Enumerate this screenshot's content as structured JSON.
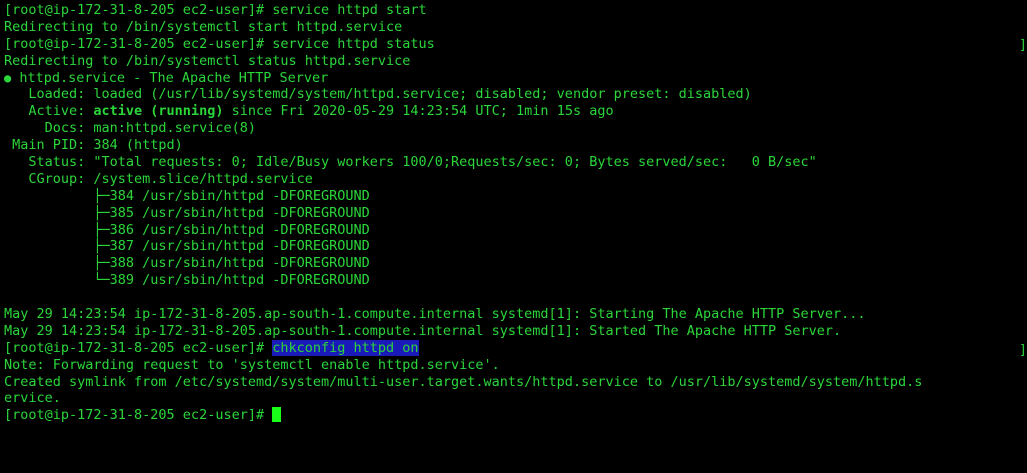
{
  "terminal": {
    "lines": {
      "l1": "[root@ip-172-31-8-205 ec2-user]# service httpd start",
      "l2": "Redirecting to /bin/systemctl start httpd.service",
      "l3": "[root@ip-172-31-8-205 ec2-user]# service httpd status",
      "l4": "Redirecting to /bin/systemctl status httpd.service",
      "l5_bullet": "●",
      "l5_text": " httpd.service - The Apache HTTP Server",
      "l6": "   Loaded: loaded (/usr/lib/systemd/system/httpd.service; disabled; vendor preset: disabled)",
      "l7_label": "   Active: ",
      "l7_status": "active (running)",
      "l7_rest": " since Fri 2020-05-29 14:23:54 UTC; 1min 15s ago",
      "l8": "     Docs: man:httpd.service(8)",
      "l9": " Main PID: 384 (httpd)",
      "l10": "   Status: \"Total requests: 0; Idle/Busy workers 100/0;Requests/sec: 0; Bytes served/sec:   0 B/sec\"",
      "l11": "   CGroup: /system.slice/httpd.service",
      "l12": "           ├─384 /usr/sbin/httpd -DFOREGROUND",
      "l13": "           ├─385 /usr/sbin/httpd -DFOREGROUND",
      "l14": "           ├─386 /usr/sbin/httpd -DFOREGROUND",
      "l15": "           ├─387 /usr/sbin/httpd -DFOREGROUND",
      "l16": "           ├─388 /usr/sbin/httpd -DFOREGROUND",
      "l17": "           └─389 /usr/sbin/httpd -DFOREGROUND",
      "l18": "",
      "l19": "May 29 14:23:54 ip-172-31-8-205.ap-south-1.compute.internal systemd[1]: Starting The Apache HTTP Server...",
      "l20": "May 29 14:23:54 ip-172-31-8-205.ap-south-1.compute.internal systemd[1]: Started The Apache HTTP Server.",
      "l21_prompt": "[root@ip-172-31-8-205 ec2-user]# ",
      "l21_cmd": "chkconfig httpd on",
      "l22": "Note: Forwarding request to 'systemctl enable httpd.service'.",
      "l23": "Created symlink from /etc/systemd/system/multi-user.target.wants/httpd.service to /usr/lib/systemd/system/httpd.s",
      "l24": "ervice.",
      "l25_prompt": "[root@ip-172-31-8-205 ec2-user]# "
    }
  },
  "colors": {
    "background": "#000000",
    "text": "#2bd63a",
    "highlight": "#1a1ab8",
    "cursor": "#19ff19"
  }
}
